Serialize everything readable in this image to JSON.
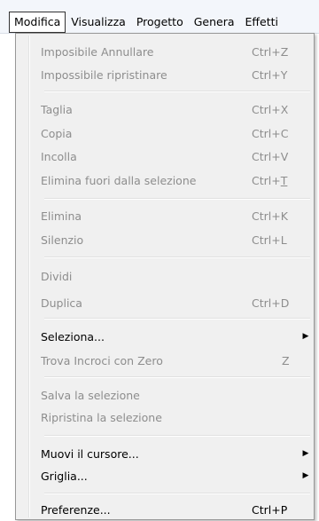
{
  "menubar": {
    "items": [
      "Modifica",
      "Visualizza",
      "Progetto",
      "Genera",
      "Effetti"
    ]
  },
  "menu": {
    "items": [
      {
        "label": "Imposibile Annullare",
        "shortcut": "Ctrl+Z",
        "enabled": false
      },
      {
        "label": "Impossibile ripristinare",
        "shortcut": "Ctrl+Y",
        "enabled": false
      },
      {
        "label": "Taglia",
        "shortcut": "Ctrl+X",
        "enabled": false
      },
      {
        "label": "Copia",
        "shortcut": "Ctrl+C",
        "enabled": false
      },
      {
        "label": "Incolla",
        "shortcut": "Ctrl+V",
        "enabled": false
      },
      {
        "label": "Elimina fuori dalla selezione",
        "shortcut": "Ctrl+T",
        "enabled": false
      },
      {
        "label": "Elimina",
        "shortcut": "Ctrl+K",
        "enabled": false
      },
      {
        "label": "Silenzio",
        "shortcut": "Ctrl+L",
        "enabled": false
      },
      {
        "label": "Dividi",
        "shortcut": "",
        "enabled": false
      },
      {
        "label": "Duplica",
        "shortcut": "Ctrl+D",
        "enabled": false
      },
      {
        "label": "Seleziona...",
        "shortcut": "",
        "enabled": true,
        "submenu": true
      },
      {
        "label": "Trova Incroci con Zero",
        "shortcut": "Z",
        "enabled": false
      },
      {
        "label": "Salva la selezione",
        "shortcut": "",
        "enabled": false
      },
      {
        "label": "Ripristina la selezione",
        "shortcut": "",
        "enabled": false
      },
      {
        "label": "Muovi il cursore...",
        "shortcut": "",
        "enabled": true,
        "submenu": true
      },
      {
        "label": "Griglia...",
        "shortcut": "",
        "enabled": true,
        "submenu": true
      },
      {
        "label": "Preferenze...",
        "shortcut": "Ctrl+P",
        "enabled": true
      }
    ],
    "submenu_arrow": "▶"
  }
}
